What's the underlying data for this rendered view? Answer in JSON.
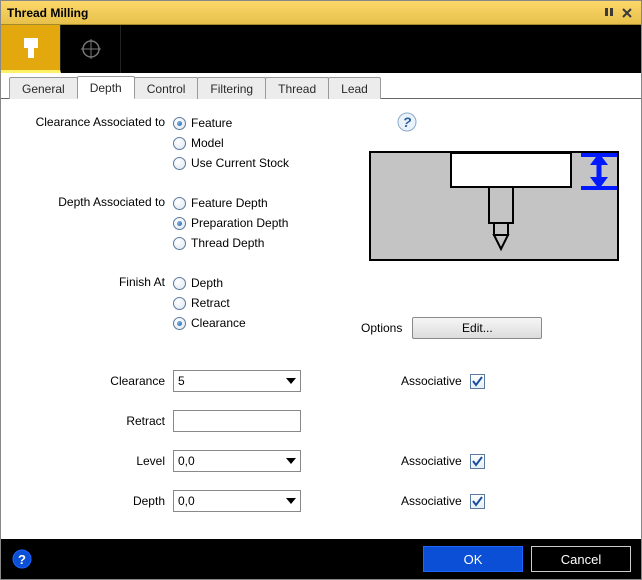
{
  "title": "Thread Milling",
  "tabs": [
    "General",
    "Depth",
    "Control",
    "Filtering",
    "Thread",
    "Lead"
  ],
  "active_tab": "Depth",
  "groups": {
    "clearance_assoc": {
      "label": "Clearance Associated to",
      "options": [
        "Feature",
        "Model",
        "Use Current Stock"
      ],
      "selected": "Feature"
    },
    "depth_assoc": {
      "label": "Depth Associated to",
      "options": [
        "Feature Depth",
        "Preparation Depth",
        "Thread Depth"
      ],
      "selected": "Preparation Depth"
    },
    "finish_at": {
      "label": "Finish At",
      "options": [
        "Depth",
        "Retract",
        "Clearance"
      ],
      "selected": "Clearance"
    }
  },
  "options_label": "Options",
  "edit_label": "Edit...",
  "associative_label": "Associative",
  "inputs": {
    "clearance": {
      "label": "Clearance",
      "value": "5",
      "dropdown": true,
      "assoc": true,
      "assoc_checked": true
    },
    "retract": {
      "label": "Retract",
      "value": "",
      "dropdown": false,
      "assoc": false
    },
    "level": {
      "label": "Level",
      "value": "0,0",
      "dropdown": true,
      "assoc": true,
      "assoc_checked": true
    },
    "depth": {
      "label": "Depth",
      "value": "0,0",
      "dropdown": true,
      "assoc": true,
      "assoc_checked": true
    }
  },
  "footer": {
    "ok": "OK",
    "cancel": "Cancel"
  }
}
